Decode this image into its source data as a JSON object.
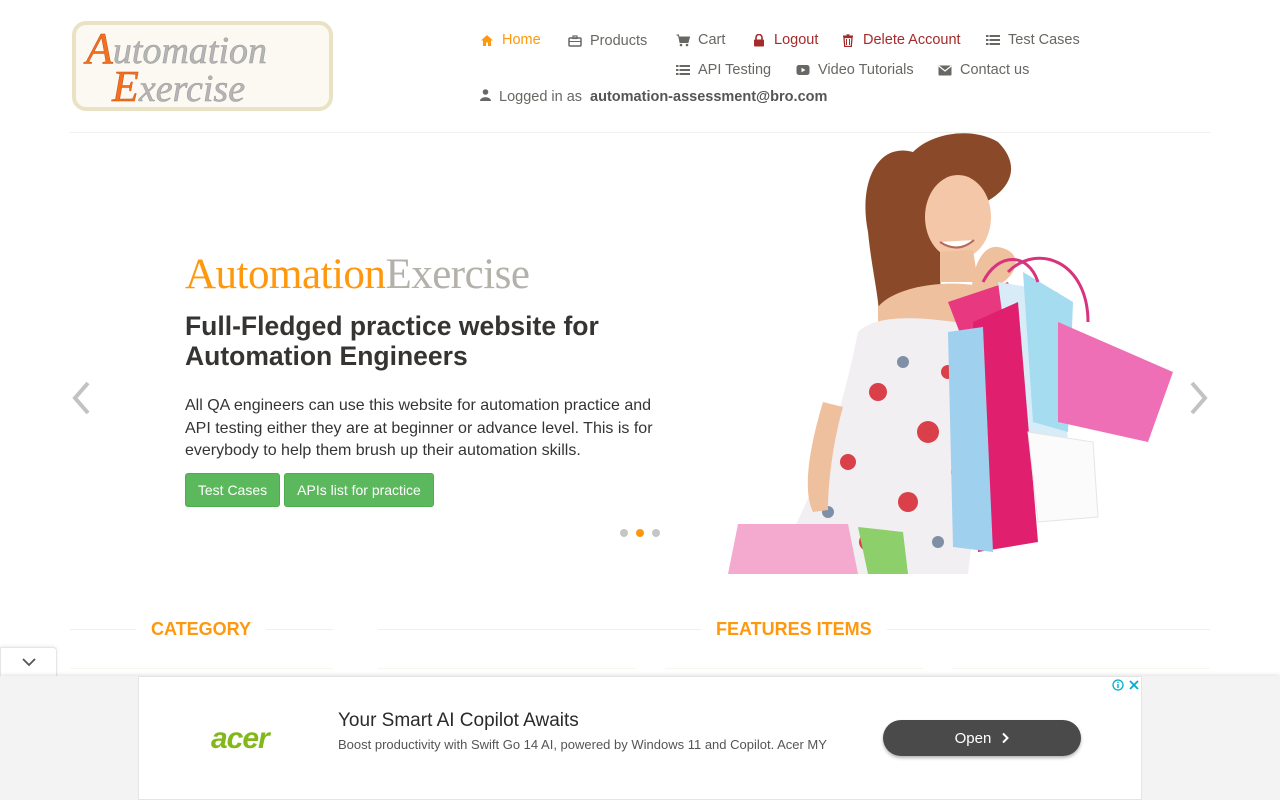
{
  "logo": {
    "line1": "Automation",
    "line2": "Exercise"
  },
  "nav": {
    "home": "Home",
    "products": "Products",
    "cart": "Cart",
    "logout": "Logout",
    "delete_account": "Delete Account",
    "test_cases": "Test Cases",
    "api_testing": "API Testing",
    "video_tutorials": "Video Tutorials",
    "contact_us": "Contact us",
    "logged_in_prefix": "Logged in as",
    "logged_in_user": "automation-assessment@bro.com"
  },
  "slider": {
    "brand_a": "Automation",
    "brand_b": "Exercise",
    "heading": "Full-Fledged practice website for Automation Engineers",
    "text": "All QA engineers can use this website for automation practice and API testing either they are at beginner or advance level. This is for everybody to help them brush up their automation skills.",
    "btn_test_cases": "Test Cases",
    "btn_apis": "APIs list for practice",
    "active_slide": 2,
    "slide_count": 3
  },
  "sections": {
    "category": "Category",
    "features": "Features Items"
  },
  "ad": {
    "brand": "acer",
    "headline": "Your Smart AI Copilot Awaits",
    "text": "Boost productivity with Swift Go 14 AI, powered by Windows 11 and Copilot. Acer MY",
    "cta": "Open"
  },
  "colors": {
    "accent": "#FE980F",
    "brand_gray": "#B4B1AB",
    "button_green": "#5cb85c",
    "danger": "#a52a2a"
  },
  "icons": [
    "home-icon",
    "briefcase-icon",
    "cart-icon",
    "lock-icon",
    "trash-icon",
    "list-icon",
    "video-icon",
    "envelope-icon",
    "user-icon",
    "chevron-left-icon",
    "chevron-right-icon",
    "chevron-down-icon",
    "adchoices-icon",
    "close-icon"
  ]
}
